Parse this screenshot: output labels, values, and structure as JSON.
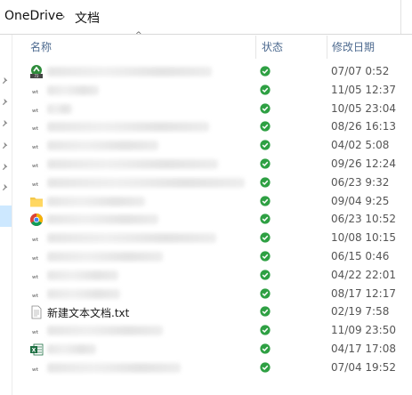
{
  "breadcrumb": {
    "root": "OneDrive",
    "current": "文档"
  },
  "columns": {
    "name": "名称",
    "status": "状态",
    "modified": "修改日期"
  },
  "rows": [
    {
      "icon": "app-shortcut-icon",
      "name": "",
      "date": "07/07 0:52",
      "nameWidth": 185
    },
    {
      "icon": "generic-file-icon",
      "name": "",
      "date": "11/05 12:37",
      "nameWidth": 58
    },
    {
      "icon": "generic-file-icon",
      "name": "",
      "date": "10/05 23:04",
      "nameWidth": 28
    },
    {
      "icon": "generic-file-icon",
      "name": "",
      "date": "08/26 16:13",
      "nameWidth": 182
    },
    {
      "icon": "generic-file-icon",
      "name": "",
      "date": "04/02 5:08",
      "nameWidth": 125
    },
    {
      "icon": "generic-file-icon",
      "name": "",
      "date": "09/26 12:24",
      "nameWidth": 192
    },
    {
      "icon": "generic-file-icon",
      "name": "",
      "date": "06/23 9:32",
      "nameWidth": 222
    },
    {
      "icon": "folder-icon",
      "name": "",
      "date": "09/04 9:25",
      "nameWidth": 110
    },
    {
      "icon": "chrome-icon",
      "name": "",
      "date": "06/23 10:52",
      "nameWidth": 125
    },
    {
      "icon": "generic-file-icon",
      "name": "",
      "date": "10/08 10:15",
      "nameWidth": 190
    },
    {
      "icon": "generic-file-icon",
      "name": "",
      "date": "06/15 0:46",
      "nameWidth": 130
    },
    {
      "icon": "generic-file-icon",
      "name": "",
      "date": "04/22 22:01",
      "nameWidth": 80
    },
    {
      "icon": "generic-file-icon",
      "name": "",
      "date": "08/17 12:17",
      "nameWidth": 82
    },
    {
      "icon": "text-file-icon",
      "name": "新建文本文档.txt",
      "date": "02/19 7:58",
      "nameWidth": 0
    },
    {
      "icon": "generic-file-icon",
      "name": "",
      "date": "11/09 23:50",
      "nameWidth": 130
    },
    {
      "icon": "excel-file-icon",
      "name": "",
      "date": "04/17 17:08",
      "nameWidth": 55
    },
    {
      "icon": "generic-file-icon",
      "name": "",
      "date": "07/04 19:52",
      "nameWidth": 150
    }
  ],
  "colors": {
    "status_green": "#2ea043",
    "header_text": "#4d6a8f",
    "selection": "#cde8ff"
  }
}
